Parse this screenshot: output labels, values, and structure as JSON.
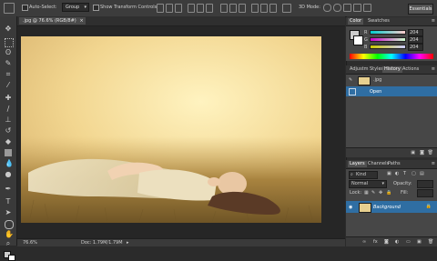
{
  "options": {
    "auto_select_label": "Auto-Select:",
    "auto_select_mode": "Group",
    "transform_label": "Show Transform Controls",
    "mode_3d": "3D Mode:",
    "workspace": "Essentials"
  },
  "document": {
    "tab_title": ".jpg @ 76.6% (RGB/8#)"
  },
  "status": {
    "zoom": "76.6%",
    "doc_info": "Doc: 1.79M/1.79M"
  },
  "color_panel": {
    "tabs": [
      "Color",
      "Swatches"
    ],
    "channels": [
      {
        "label": "R",
        "value": "204"
      },
      {
        "label": "G",
        "value": "204"
      },
      {
        "label": "B",
        "value": "204"
      }
    ],
    "foreground_color": "#cccccc"
  },
  "history_panel": {
    "tabs": [
      "Adjustm",
      "Styles",
      "History",
      "Actions"
    ],
    "items": [
      {
        "label": ".jpg",
        "selected": false
      },
      {
        "label": "Open",
        "selected": true
      }
    ]
  },
  "layers_panel": {
    "tabs": [
      "Layers",
      "Channels",
      "Paths"
    ],
    "kind_label": "Kind",
    "blend_mode": "Normal",
    "opacity_label": "Opacity:",
    "lock_label": "Lock:",
    "fill_label": "Fill:",
    "layer_name": "Background"
  },
  "colors": {
    "accent_selection": "#2f6ea3",
    "workspace_bg": "#262626"
  }
}
